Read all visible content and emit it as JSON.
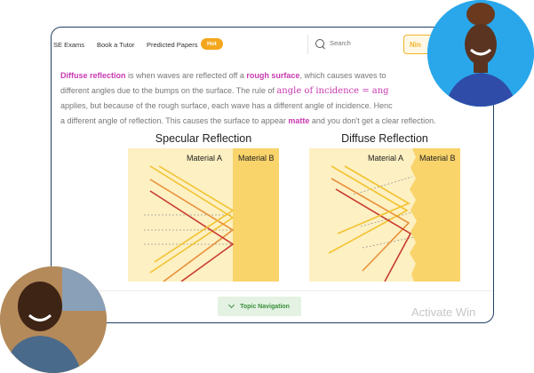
{
  "nav": {
    "items": [
      "SE Exams",
      "Book a Tutor",
      "Predicted Papers"
    ],
    "badge": "Hot",
    "search_placeholder": "Search",
    "cta_label": "Nin"
  },
  "content": {
    "line1": {
      "term": "Diffuse reflection",
      "mid": " is when waves are reflected off a ",
      "bold2": "rough surface",
      "tail": ", which causes waves to"
    },
    "line2": {
      "text": "different angles due to the bumps on the surface. The rule of ",
      "math": "angle of incidence = ang"
    },
    "line3": {
      "text": "applies, but because of the rough surface, each wave has a different angle of incidence. Henc"
    },
    "line4": {
      "text1": "a different angle of reflection. This causes the surface to appear ",
      "bold": "matte",
      "text2": " and you don't get a clear reflection."
    }
  },
  "diagrams": {
    "specular": {
      "title": "Specular Reflection",
      "material_a": "Material A",
      "material_b": "Material B"
    },
    "diffuse": {
      "title": "Diffuse Reflection",
      "material_a": "Material A",
      "material_b": "Material B"
    }
  },
  "colors": {
    "accent_pink": "#c73ab0",
    "badge_orange": "#f4a71d",
    "material_a_fill": "#fdf0c2",
    "material_b_fill": "#f9d46b",
    "ray_yellow": "#f2c230",
    "ray_orange": "#e8903a",
    "ray_red": "#c93a30",
    "frame_border": "#1f3f63"
  },
  "footer": {
    "topic_nav": "Topic Navigation",
    "watermark": "Activate Win"
  },
  "avatars": [
    "woman-avatar",
    "child-avatar"
  ]
}
